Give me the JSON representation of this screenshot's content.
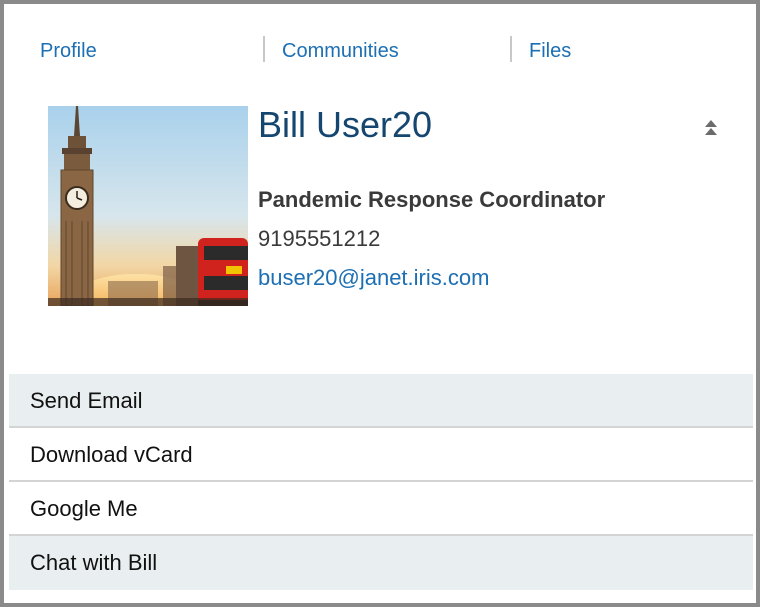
{
  "tabs": [
    {
      "label": "Profile"
    },
    {
      "label": "Communities"
    },
    {
      "label": "Files"
    }
  ],
  "profile": {
    "name": "Bill User20",
    "job_title": "Pandemic Response Coordinator",
    "phone": "9195551212",
    "email": "buser20@janet.iris.com",
    "collapse_icon": "chevron-double-up-icon"
  },
  "actions": [
    {
      "label": "Send Email"
    },
    {
      "label": "Download vCard"
    },
    {
      "label": "Google Me"
    },
    {
      "label": "Chat with Bill"
    }
  ],
  "colors": {
    "link": "#1d6fb4",
    "name": "#15466f",
    "shaded_row": "#e9eff1",
    "border": "#8a8a8a"
  }
}
